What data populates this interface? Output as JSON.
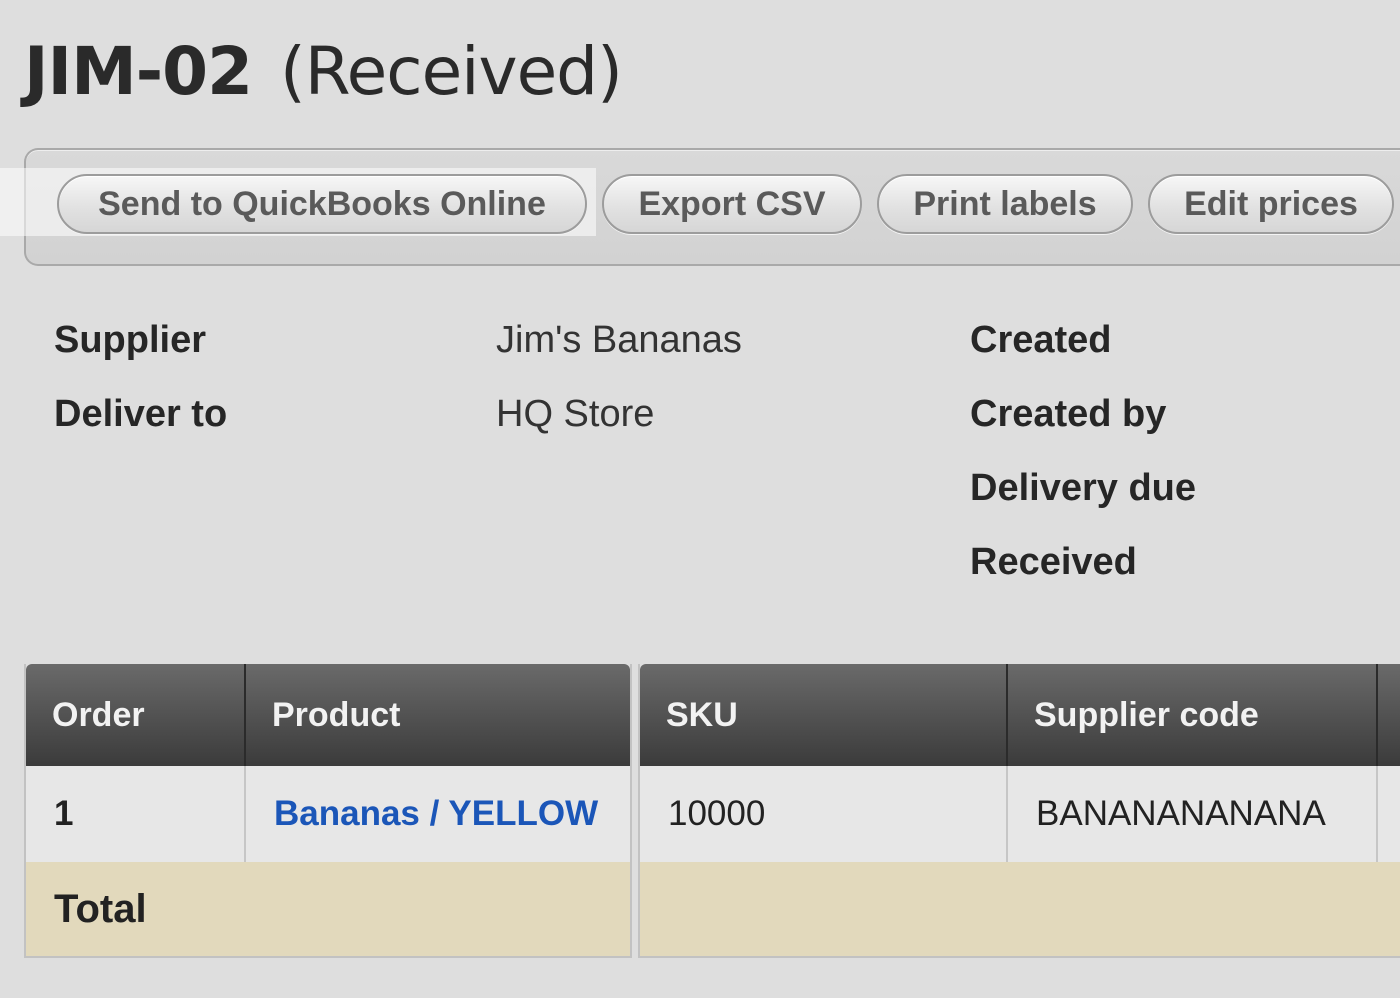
{
  "header": {
    "code": "JIM-02",
    "status": "(Received)"
  },
  "toolbar": {
    "send_qbo_label": "Send to QuickBooks Online",
    "export_csv_label": "Export CSV",
    "print_labels_label": "Print labels",
    "edit_prices_label": "Edit prices"
  },
  "details": {
    "supplier_label": "Supplier",
    "supplier_value": "Jim's Bananas",
    "deliver_to_label": "Deliver to",
    "deliver_to_value": "HQ Store",
    "created_label": "Created",
    "created_by_label": "Created by",
    "delivery_due_label": "Delivery due",
    "received_label": "Received"
  },
  "table": {
    "columns": [
      "Order",
      "Product",
      "SKU",
      "Supplier code"
    ],
    "rows": [
      {
        "order": "1",
        "product": "Bananas / YELLOW",
        "sku": "10000",
        "supplier_code": "BANANANANANA"
      }
    ],
    "total_label": "Total"
  },
  "colors": {
    "background": "#dedede",
    "link": "#1b56b8",
    "header_dark": "#3b3b3b",
    "total_row": "#e2d9bc"
  }
}
